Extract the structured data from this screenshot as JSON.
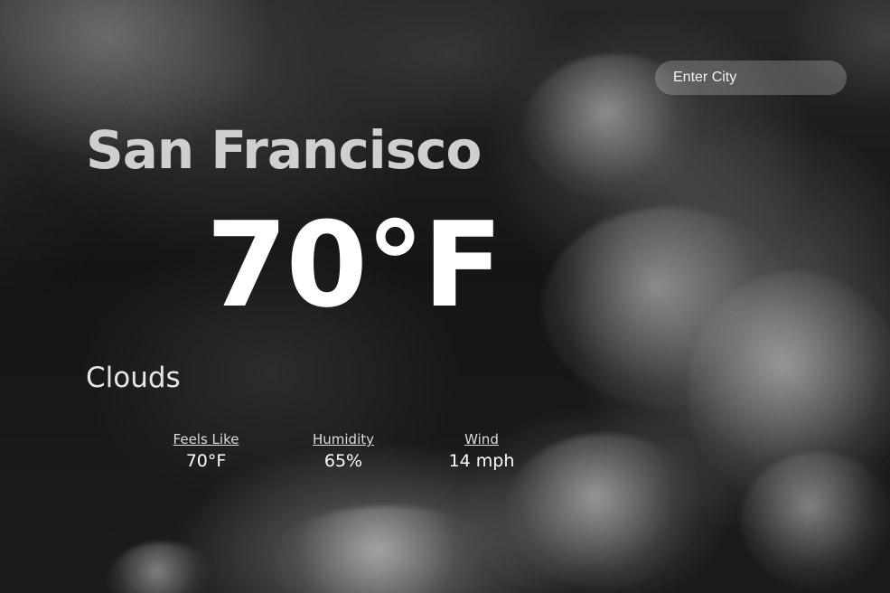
{
  "search": {
    "placeholder": "Enter City"
  },
  "weather": {
    "city": "San Francisco",
    "temperature": "70°F",
    "condition": "Clouds"
  },
  "stats": [
    {
      "label": "Feels Like",
      "value": "70°F"
    },
    {
      "label": "Humidity",
      "value": "65%"
    },
    {
      "label": "Wind",
      "value": "14 mph"
    }
  ],
  "colors": {
    "text_primary": "#ffffff",
    "city_text": "#cfcfcf",
    "search_bg": "rgba(255,255,255,0.22)"
  }
}
